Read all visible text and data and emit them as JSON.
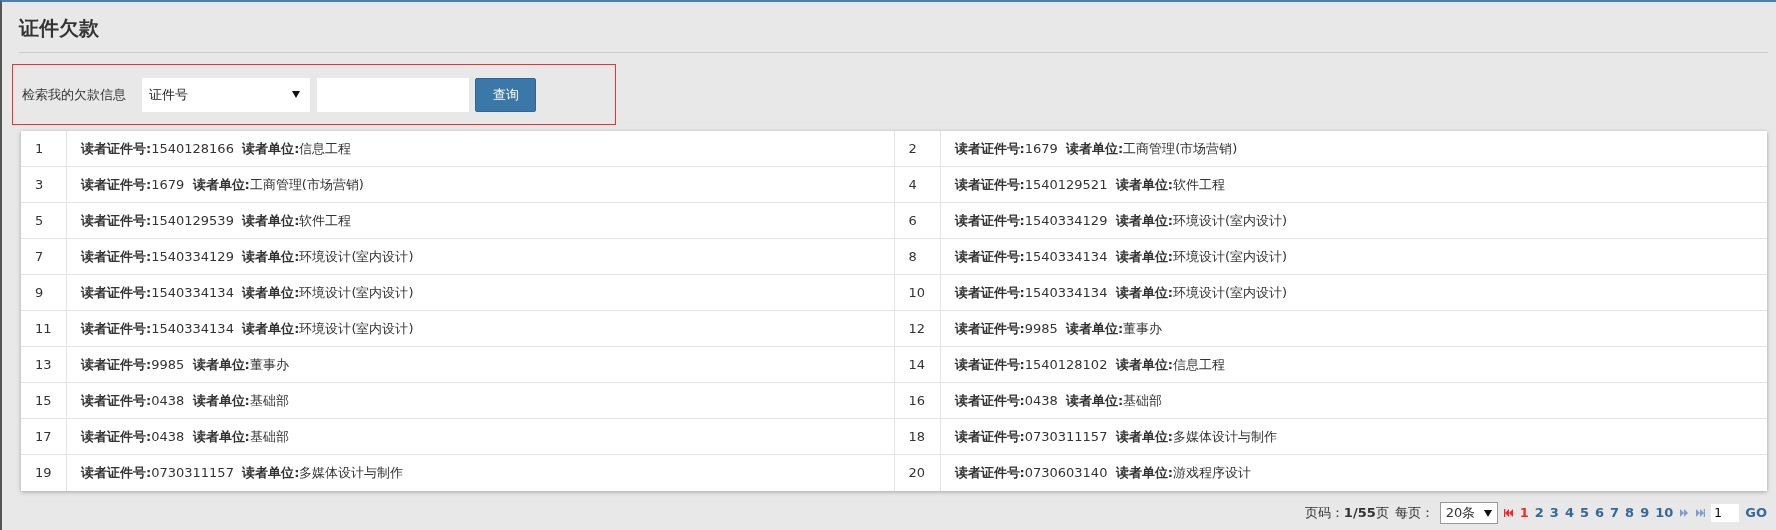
{
  "title": "证件欠款",
  "search": {
    "label": "检索我的欠款信息",
    "select_value": "证件号",
    "button": "查询"
  },
  "entries": [
    {
      "index": "1",
      "text": "**读者证件号:**1540128166  **读者单位:**信息工程"
    },
    {
      "index": "2",
      "text": "**读者证件号:**1679  **读者单位:**工商管理(市场营销)"
    },
    {
      "index": "3",
      "text": "**读者证件号:**1679  **读者单位:**工商管理(市场营销)"
    },
    {
      "index": "4",
      "text": "**读者证件号:**1540129521  **读者单位:**软件工程"
    },
    {
      "index": "5",
      "text": "**读者证件号:**1540129539  **读者单位:**软件工程"
    },
    {
      "index": "6",
      "text": "**读者证件号:**1540334129  **读者单位:**环境设计(室内设计)"
    },
    {
      "index": "7",
      "text": "**读者证件号:**1540334129  **读者单位:**环境设计(室内设计)"
    },
    {
      "index": "8",
      "text": "**读者证件号:**1540334134  **读者单位:**环境设计(室内设计)"
    },
    {
      "index": "9",
      "text": "**读者证件号:**1540334134  **读者单位:**环境设计(室内设计)"
    },
    {
      "index": "10",
      "text": "**读者证件号:**1540334134  **读者单位:**环境设计(室内设计)"
    },
    {
      "index": "11",
      "text": "**读者证件号:**1540334134  **读者单位:**环境设计(室内设计)"
    },
    {
      "index": "12",
      "text": "**读者证件号:**9985  **读者单位:**董事办"
    },
    {
      "index": "13",
      "text": "**读者证件号:**9985  **读者单位:**董事办"
    },
    {
      "index": "14",
      "text": "**读者证件号:**1540128102  **读者单位:**信息工程"
    },
    {
      "index": "15",
      "text": "**读者证件号:**0438  **读者单位:**基础部"
    },
    {
      "index": "16",
      "text": "**读者证件号:**0438  **读者单位:**基础部"
    },
    {
      "index": "17",
      "text": "**读者证件号:**0438  **读者单位:**基础部"
    },
    {
      "index": "18",
      "text": "**读者证件号:**0730311157  **读者单位:**多媒体设计与制作"
    },
    {
      "index": "19",
      "text": "**读者证件号:**0730311157  **读者单位:**多媒体设计与制作"
    },
    {
      "index": "20",
      "text": "**读者证件号:**0730603140  **读者单位:**游戏程序设计"
    }
  ],
  "pagination": {
    "page_info": "页码：**1/55**页",
    "per_page_label": "每页：",
    "per_page_value": "20条",
    "pages": [
      {
        "label": "1",
        "selected": true
      },
      {
        "label": "2",
        "selected": false
      },
      {
        "label": "3",
        "selected": false
      },
      {
        "label": "4",
        "selected": false
      },
      {
        "label": "5",
        "selected": false
      },
      {
        "label": "6",
        "selected": false
      },
      {
        "label": "7",
        "selected": false
      },
      {
        "label": "8",
        "selected": false
      },
      {
        "label": "9",
        "selected": false
      },
      {
        "label": "10",
        "selected": false
      }
    ],
    "page_input": "1",
    "go": "GO"
  }
}
